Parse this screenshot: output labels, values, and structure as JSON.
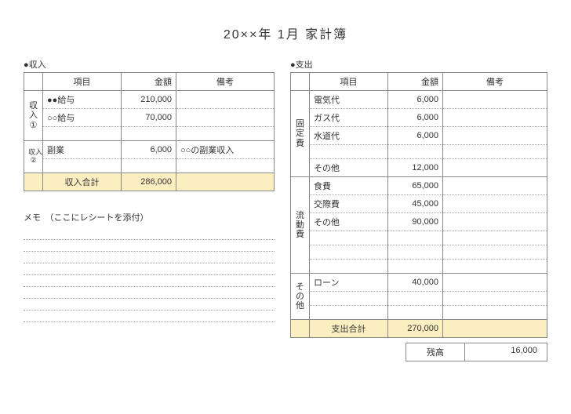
{
  "title": "20××年 1月 家計簿",
  "income": {
    "heading": "●収入",
    "headers": {
      "item": "項目",
      "amount": "金額",
      "note": "備考"
    },
    "group1": {
      "side": [
        "収",
        "入",
        "①"
      ],
      "rows": [
        {
          "item": "●●給与",
          "amount": "210,000",
          "note": ""
        },
        {
          "item": "○○給与",
          "amount": "70,000",
          "note": ""
        },
        {
          "item": "",
          "amount": "",
          "note": ""
        }
      ]
    },
    "group2": {
      "side": [
        "収入",
        "②"
      ],
      "rows": [
        {
          "item": "副業",
          "amount": "6,000",
          "note": "○○の副業収入"
        },
        {
          "item": "",
          "amount": "",
          "note": ""
        }
      ]
    },
    "total": {
      "label": "収入合計",
      "amount": "286,000"
    }
  },
  "expense": {
    "heading": "●支出",
    "headers": {
      "item": "項目",
      "amount": "金額",
      "note": "備考"
    },
    "fixed": {
      "side": [
        "固",
        "定",
        "費"
      ],
      "rows": [
        {
          "item": "電気代",
          "amount": "6,000",
          "note": ""
        },
        {
          "item": "ガス代",
          "amount": "6,000",
          "note": ""
        },
        {
          "item": "水道代",
          "amount": "6,000",
          "note": ""
        },
        {
          "item": "",
          "amount": "",
          "note": ""
        },
        {
          "item": "その他",
          "amount": "12,000",
          "note": ""
        }
      ]
    },
    "variable": {
      "side": [
        "流",
        "動",
        "費"
      ],
      "rows": [
        {
          "item": "食費",
          "amount": "65,000",
          "note": ""
        },
        {
          "item": "交際費",
          "amount": "45,000",
          "note": ""
        },
        {
          "item": "その他",
          "amount": "90,000",
          "note": ""
        },
        {
          "item": "",
          "amount": "",
          "note": ""
        },
        {
          "item": "",
          "amount": "",
          "note": ""
        },
        {
          "item": "",
          "amount": "",
          "note": ""
        }
      ]
    },
    "other": {
      "side": [
        "そ",
        "の",
        "他"
      ],
      "rows": [
        {
          "item": "ローン",
          "amount": "40,000",
          "note": ""
        },
        {
          "item": "",
          "amount": "",
          "note": ""
        },
        {
          "item": "",
          "amount": "",
          "note": ""
        }
      ]
    },
    "total": {
      "label": "支出合計",
      "amount": "270,000"
    }
  },
  "memo": {
    "heading": "メモ　（ここにレシートを添付）"
  },
  "balance": {
    "label": "残高",
    "amount": "16,000"
  }
}
